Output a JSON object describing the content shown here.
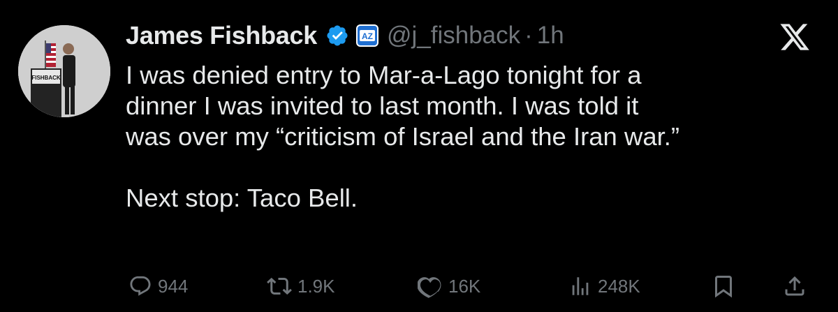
{
  "author": {
    "name": "James Fishback",
    "handle": "@j_fishback",
    "separator": "·",
    "time": "1h",
    "verified_color": "#1d9bf0",
    "affiliate_badge": "AZ"
  },
  "avatar": {
    "podium_text": "FISHBACK"
  },
  "tweet": {
    "line1": "I was denied entry to Mar-a-Lago tonight for a",
    "line2": "dinner I was invited to last month. I was told it",
    "line3": "was over my “criticism of Israel and the Iran war.”",
    "line4": "Next stop: Taco Bell."
  },
  "metrics": {
    "replies": "944",
    "reposts": "1.9K",
    "likes": "16K",
    "views": "248K"
  },
  "icons": [
    "verified-icon",
    "affiliate-badge-icon",
    "x-logo-icon",
    "reply-icon",
    "repost-icon",
    "like-icon",
    "views-icon",
    "bookmark-icon",
    "share-icon"
  ],
  "colors": {
    "background": "#000000",
    "text": "#e7e9ea",
    "muted": "#71767b",
    "accent": "#1d9bf0"
  }
}
